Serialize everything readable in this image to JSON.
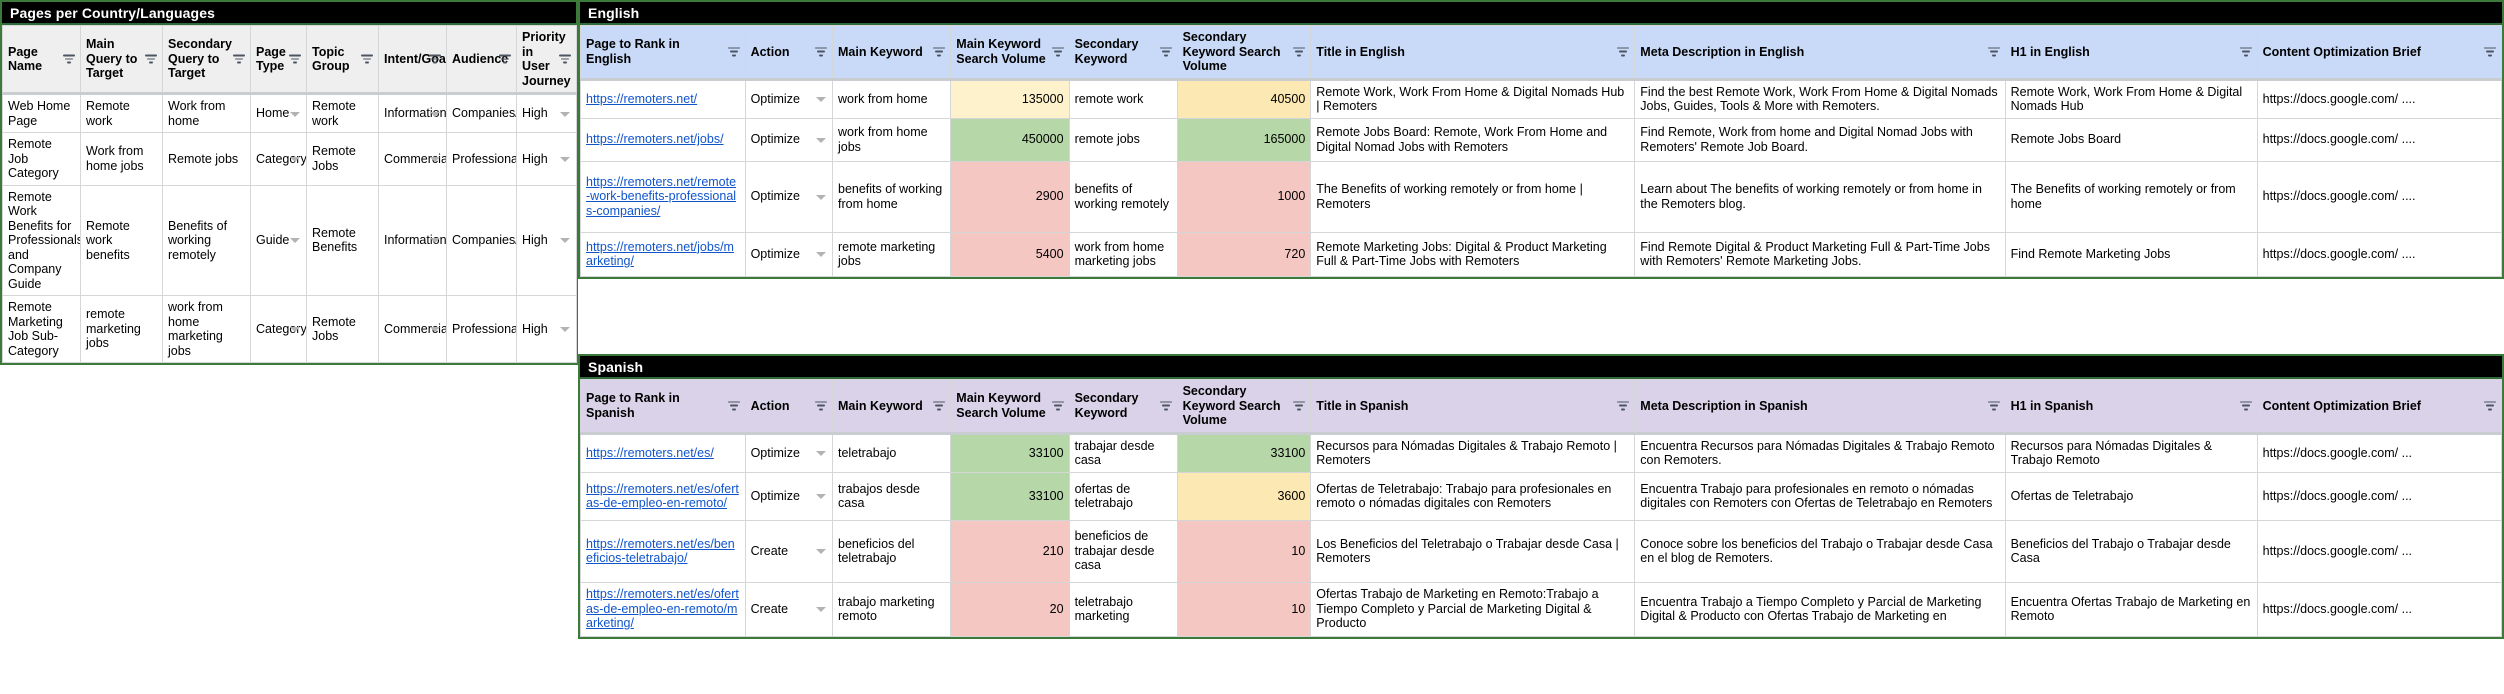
{
  "pages_sheet": {
    "title": "Pages per Country/Languages",
    "columns": [
      "Page Name",
      "Main Query to Target",
      "Secondary Query to Target",
      "Page Type",
      "Topic Group",
      "Intent/Goal",
      "Audience",
      "Priority in User Journey"
    ],
    "rows": [
      {
        "page_name": "Web Home Page",
        "main_query": "Remote work",
        "secondary_query": "Work from home",
        "page_type": "Home",
        "topic_group": "Remote work",
        "intent": "Informational",
        "audience": "Companies/Professionals",
        "priority": "High"
      },
      {
        "page_name": "Remote Job Category",
        "main_query": "Work from home jobs",
        "secondary_query": "Remote jobs",
        "page_type": "Category",
        "topic_group": "Remote Jobs",
        "intent": "Commercial",
        "audience": "Professionals",
        "priority": "High"
      },
      {
        "page_name": "Remote Work Benefits for Professionals and Company Guide",
        "main_query": "Remote work benefits",
        "secondary_query": "Benefits of working remotely",
        "page_type": "Guide",
        "topic_group": "Remote Benefits",
        "intent": "Informational",
        "audience": "Companies/Professionals",
        "priority": "High"
      },
      {
        "page_name": "Remote Marketing Job Sub-Category",
        "main_query": "remote marketing jobs",
        "secondary_query": "work from home marketing jobs",
        "page_type": "Category",
        "topic_group": "Remote Jobs",
        "intent": "Commercial",
        "audience": "Professionals",
        "priority": "High"
      }
    ]
  },
  "english_sheet": {
    "title": "English",
    "columns": [
      "Page to Rank in English",
      "Action",
      "Main Keyword",
      "Main Keyword Search Volume",
      "Secondary Keyword",
      "Secondary Keyword Search Volume",
      "Title in English",
      "Meta Description in English",
      "H1 in English",
      "Content Optimization Brief"
    ],
    "rows": [
      {
        "page_url": "https://remoters.net/",
        "action": "Optimize",
        "main_keyword": "work from home",
        "main_volume": "135000",
        "main_volume_fill": "#fdf2cc",
        "secondary_keyword": "remote work",
        "secondary_volume": "40500",
        "secondary_volume_fill": "#fce8b2",
        "title": "Remote Work, Work From Home & Digital Nomads Hub | Remoters",
        "meta": "Find the best Remote Work, Work From Home & Digital Nomads Jobs, Guides, Tools & More with Remoters.",
        "h1": "Remote Work, Work From Home & Digital Nomads Hub",
        "brief": "https://docs.google.com/ ...."
      },
      {
        "page_url": "https://remoters.net/jobs/",
        "action": "Optimize",
        "main_keyword": "work from home jobs",
        "main_volume": "450000",
        "main_volume_fill": "#b6d7a8",
        "secondary_keyword": "remote jobs",
        "secondary_volume": "165000",
        "secondary_volume_fill": "#b6d7a8",
        "title": "Remote Jobs Board: Remote, Work From Home and Digital Nomad Jobs with Remoters",
        "meta": "Find Remote, Work from home and Digital Nomad Jobs with Remoters' Remote Job Board.",
        "h1": "Remote Jobs Board",
        "brief": "https://docs.google.com/ ...."
      },
      {
        "page_url": "https://remoters.net/remote-work-benefits-professionals-companies/",
        "action": "Optimize",
        "main_keyword": "benefits of working from home",
        "main_volume": "2900",
        "main_volume_fill": "#f4c7c3",
        "secondary_keyword": "benefits of working remotely",
        "secondary_volume": "1000",
        "secondary_volume_fill": "#f4c7c3",
        "title": "The Benefits of working remotely or from home | Remoters",
        "meta": "Learn about The benefits of working remotely or from home in the Remoters blog.",
        "h1": "The Benefits of working remotely or from home",
        "brief": "https://docs.google.com/ ...."
      },
      {
        "page_url": "https://remoters.net/jobs/marketing/",
        "action": "Optimize",
        "main_keyword": "remote marketing jobs",
        "main_volume": "5400",
        "main_volume_fill": "#f4c7c3",
        "secondary_keyword": "work from home marketing jobs",
        "secondary_volume": "720",
        "secondary_volume_fill": "#f4c7c3",
        "title": "Remote Marketing Jobs: Digital & Product Marketing Full & Part-Time Jobs with Remoters",
        "meta": "Find Remote Digital & Product Marketing Full & Part-Time Jobs with Remoters' Remote Marketing Jobs.",
        "h1": "Find Remote Marketing Jobs",
        "brief": "https://docs.google.com/ ...."
      }
    ]
  },
  "spanish_sheet": {
    "title": "Spanish",
    "columns": [
      "Page to Rank in Spanish",
      "Action",
      "Main Keyword",
      "Main Keyword Search Volume",
      "Secondary Keyword",
      "Secondary Keyword Search Volume",
      "Title in Spanish",
      "Meta Description in Spanish",
      "H1 in Spanish",
      "Content Optimization Brief"
    ],
    "rows": [
      {
        "page_url": "https://remoters.net/es/",
        "action": "Optimize",
        "main_keyword": "teletrabajo",
        "main_volume": "33100",
        "main_volume_fill": "#b6d7a8",
        "secondary_keyword": "trabajar desde casa",
        "secondary_volume": "33100",
        "secondary_volume_fill": "#b6d7a8",
        "title": "Recursos para Nómadas Digitales & Trabajo Remoto | Remoters",
        "meta": "Encuentra Recursos para Nómadas Digitales & Trabajo Remoto con Remoters.",
        "h1": "Recursos para Nómadas Digitales & Trabajo Remoto",
        "brief": "https://docs.google.com/ ..."
      },
      {
        "page_url": "https://remoters.net/es/ofertas-de-empleo-en-remoto/",
        "action": "Optimize",
        "main_keyword": "trabajos desde casa",
        "main_volume": "33100",
        "main_volume_fill": "#b6d7a8",
        "secondary_keyword": "ofertas de teletrabajo",
        "secondary_volume": "3600",
        "secondary_volume_fill": "#fce8b2",
        "title": "Ofertas de Teletrabajo: Trabajo para profesionales en remoto o nómadas digitales con Remoters",
        "meta": "Encuentra Trabajo para profesionales en remoto o nómadas digitales con Remoters con Ofertas de Teletrabajo en Remoters",
        "h1": "Ofertas de Teletrabajo",
        "brief": "https://docs.google.com/ ..."
      },
      {
        "page_url": "https://remoters.net/es/beneficios-teletrabajo/",
        "action": "Create",
        "main_keyword": "beneficios del teletrabajo",
        "main_volume": "210",
        "main_volume_fill": "#f4c7c3",
        "secondary_keyword": "beneficios de trabajar desde casa",
        "secondary_volume": "10",
        "secondary_volume_fill": "#f4c7c3",
        "title": "Los Beneficios del Teletrabajo o Trabajar desde Casa | Remoters",
        "meta": "Conoce sobre los beneficios del Trabajo o Trabajar desde Casa en el blog de Remoters.",
        "h1": "Beneficios del Trabajo o Trabajar desde Casa",
        "brief": "https://docs.google.com/ ..."
      },
      {
        "page_url": "https://remoters.net/es/ofertas-de-empleo-en-remoto/marketing/",
        "action": "Create",
        "main_keyword": "trabajo marketing remoto",
        "main_volume": "20",
        "main_volume_fill": "#f4c7c3",
        "secondary_keyword": "teletrabajo marketing",
        "secondary_volume": "10",
        "secondary_volume_fill": "#f4c7c3",
        "title": "Ofertas Trabajo de Marketing en Remoto:Trabajo a Tiempo Completo y Parcial de Marketing Digital & Producto",
        "meta": "Encuentra Trabajo a Tiempo Completo y Parcial de Marketing Digital & Producto con Ofertas Trabajo de Marketing en",
        "h1": "Encuentra Ofertas Trabajo de Marketing en Remoto",
        "brief": "https://docs.google.com/ ..."
      }
    ]
  },
  "colors": {
    "title_bar": "#000000",
    "sheet_border": "#3b7a3b",
    "header_plain": "#efefef",
    "header_english": "#c9daf8",
    "header_spanish": "#d9d2e9",
    "link": "#1155cc",
    "fill_green": "#b6d7a8",
    "fill_yellow": "#fdf2cc",
    "fill_orange": "#fce8b2",
    "fill_red": "#f4c7c3"
  }
}
